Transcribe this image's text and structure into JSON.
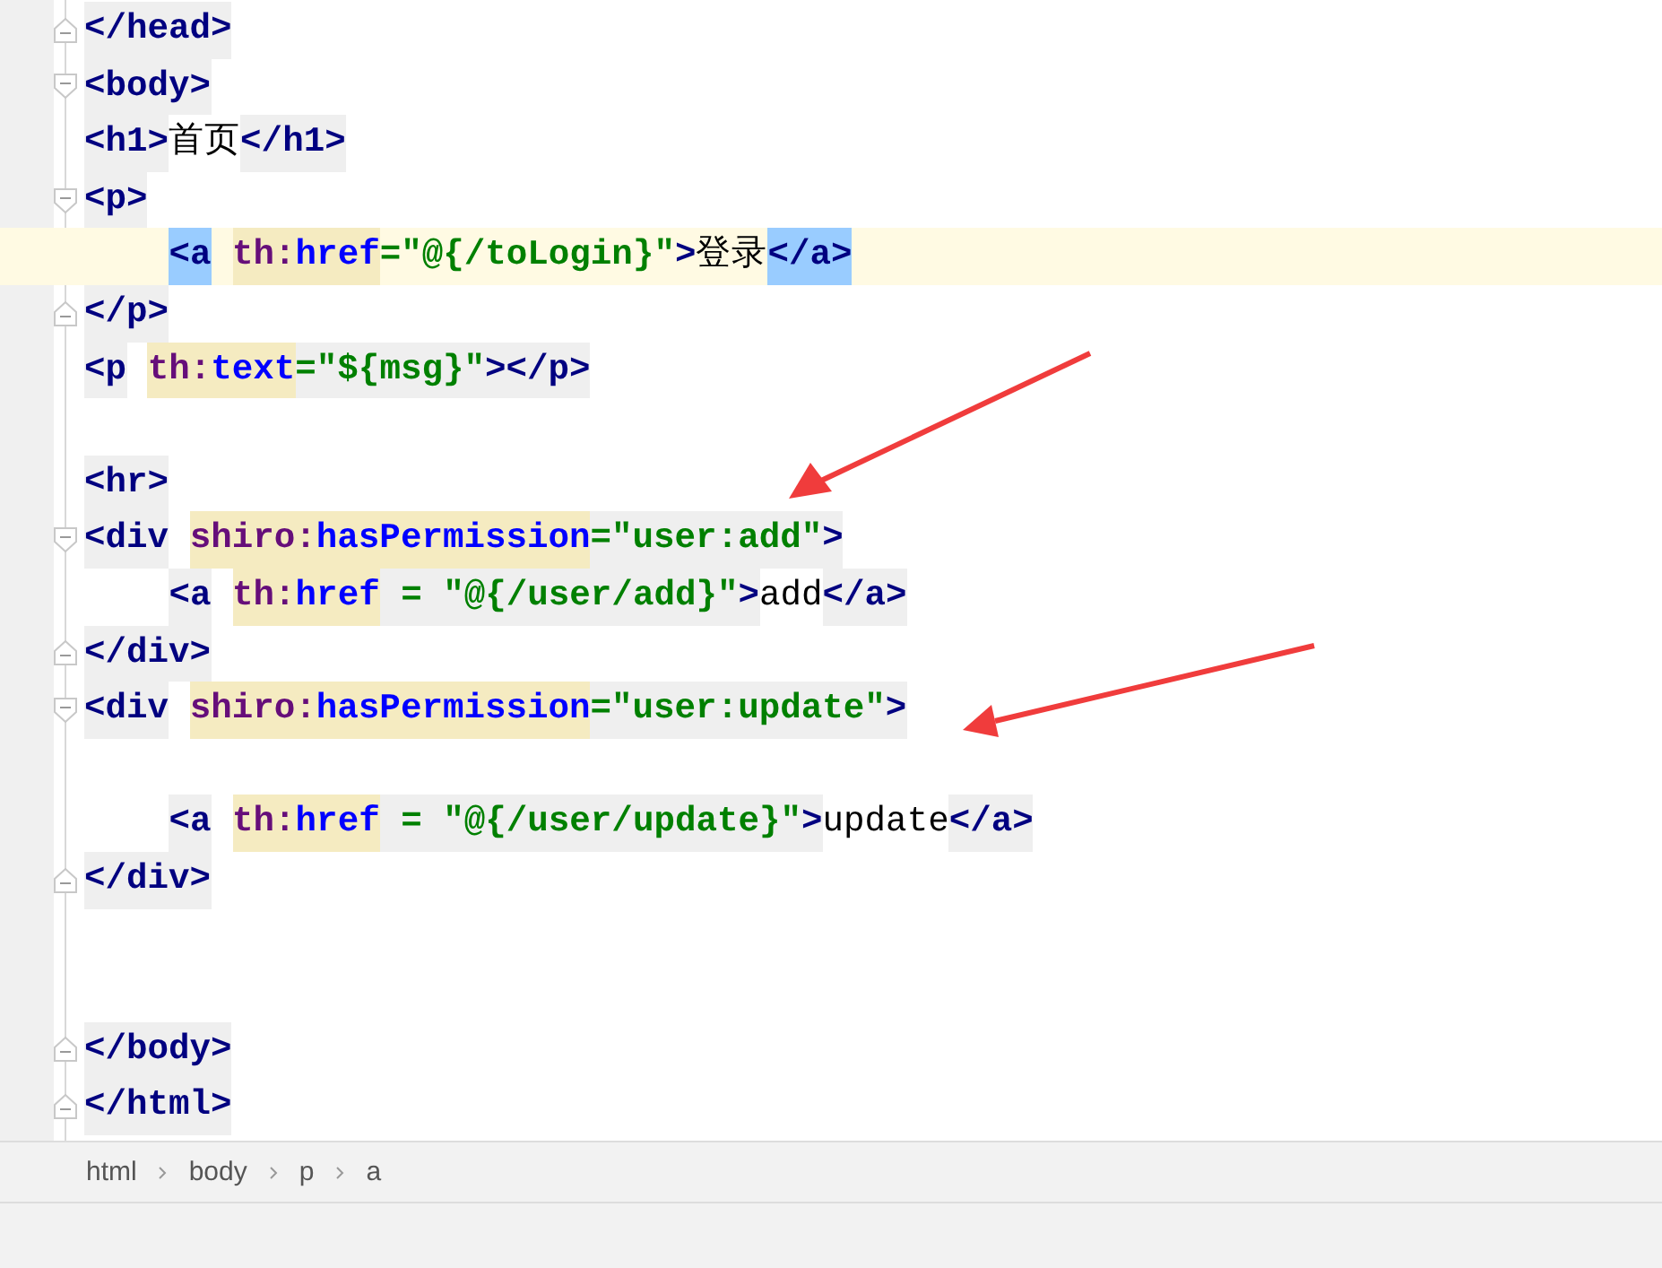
{
  "editor": {
    "lines": [
      {
        "fold_open": false,
        "fold_close": true,
        "current": false,
        "tokens": [
          {
            "kind": "tag",
            "text": "</head>",
            "in_tag": true,
            "matched": false
          }
        ]
      },
      {
        "fold_open": true,
        "fold_close": false,
        "current": false,
        "tokens": [
          {
            "kind": "tag",
            "text": "<body>",
            "in_tag": true,
            "matched": false
          }
        ]
      },
      {
        "fold_open": false,
        "fold_close": false,
        "current": false,
        "tokens": [
          {
            "kind": "tag",
            "text": "<h1>",
            "in_tag": true,
            "matched": false
          },
          {
            "kind": "text",
            "text": "首页",
            "in_tag": false,
            "matched": false
          },
          {
            "kind": "tag",
            "text": "</h1>",
            "in_tag": true,
            "matched": false
          }
        ]
      },
      {
        "fold_open": true,
        "fold_close": false,
        "current": false,
        "tokens": [
          {
            "kind": "tag",
            "text": "<p>",
            "in_tag": true,
            "matched": false
          }
        ]
      },
      {
        "fold_open": false,
        "fold_close": false,
        "current": true,
        "indented": true,
        "tokens": [
          {
            "kind": "tag",
            "text": "<a",
            "in_tag": false,
            "matched": true
          },
          {
            "kind": "ns",
            "text": "th:"
          },
          {
            "kind": "attr",
            "text": "href"
          },
          {
            "kind": "str",
            "text": "=\"@{/toLogin}\"",
            "in_tag": false,
            "matched": false
          },
          {
            "kind": "tag",
            "text": ">",
            "in_tag": false,
            "matched": false
          },
          {
            "kind": "text",
            "text": "登录",
            "in_tag": false,
            "matched": false
          },
          {
            "kind": "tag",
            "text": "</a>",
            "in_tag": false,
            "matched": true
          }
        ]
      },
      {
        "fold_open": false,
        "fold_close": true,
        "current": false,
        "tokens": [
          {
            "kind": "tag",
            "text": "</p>",
            "in_tag": true,
            "matched": false
          }
        ]
      },
      {
        "fold_open": false,
        "fold_close": false,
        "current": false,
        "tokens": [
          {
            "kind": "tag",
            "text": "<p",
            "in_tag": true,
            "matched": false
          },
          {
            "kind": "ns",
            "text": "th:"
          },
          {
            "kind": "attr",
            "text": "text"
          },
          {
            "kind": "str",
            "text": "=\"${msg}\"",
            "in_tag": true,
            "matched": false
          },
          {
            "kind": "tag",
            "text": "></p>",
            "in_tag": true,
            "matched": false
          }
        ]
      },
      {
        "fold_open": false,
        "fold_close": false,
        "current": false
      },
      {
        "fold_open": false,
        "fold_close": false,
        "current": false,
        "tokens": [
          {
            "kind": "tag",
            "text": "<hr>",
            "in_tag": true,
            "matched": false
          }
        ]
      },
      {
        "fold_open": true,
        "fold_close": false,
        "current": false,
        "tokens": [
          {
            "kind": "tag",
            "text": "<div",
            "in_tag": true,
            "matched": false
          },
          {
            "kind": "ns",
            "text": "shiro:"
          },
          {
            "kind": "attr",
            "text": "hasPermission"
          },
          {
            "kind": "str",
            "text": "=\"user:add\"",
            "in_tag": true,
            "matched": false
          },
          {
            "kind": "tag",
            "text": ">",
            "in_tag": true,
            "matched": false
          }
        ]
      },
      {
        "fold_open": false,
        "fold_close": false,
        "current": false,
        "indented": true,
        "tokens": [
          {
            "kind": "tag",
            "text": "<a",
            "in_tag": true,
            "matched": false
          },
          {
            "kind": "ns",
            "text": "th:"
          },
          {
            "kind": "attr",
            "text": "href"
          },
          {
            "kind": "str",
            "text": " = \"@{/user/add}\"",
            "in_tag": true,
            "matched": false
          },
          {
            "kind": "tag",
            "text": ">",
            "in_tag": true,
            "matched": false
          },
          {
            "kind": "text",
            "text": "add",
            "in_tag": false,
            "matched": false
          },
          {
            "kind": "tag",
            "text": "</a>",
            "in_tag": true,
            "matched": false
          }
        ]
      },
      {
        "fold_open": false,
        "fold_close": true,
        "current": false,
        "tokens": [
          {
            "kind": "tag",
            "text": "</div>",
            "in_tag": true,
            "matched": false
          }
        ]
      },
      {
        "fold_open": true,
        "fold_close": false,
        "current": false,
        "tokens": [
          {
            "kind": "tag",
            "text": "<div",
            "in_tag": true,
            "matched": false
          },
          {
            "kind": "ns",
            "text": "shiro:"
          },
          {
            "kind": "attr",
            "text": "hasPermission"
          },
          {
            "kind": "str",
            "text": "=\"user:update\"",
            "in_tag": true,
            "matched": false
          },
          {
            "kind": "tag",
            "text": ">",
            "in_tag": true,
            "matched": false
          }
        ]
      },
      {
        "fold_open": false,
        "fold_close": false,
        "current": false
      },
      {
        "fold_open": false,
        "fold_close": false,
        "current": false,
        "indented": true,
        "tokens": [
          {
            "kind": "tag",
            "text": "<a",
            "in_tag": true,
            "matched": false
          },
          {
            "kind": "ns",
            "text": "th:"
          },
          {
            "kind": "attr",
            "text": "href"
          },
          {
            "kind": "str",
            "text": " = \"@{/user/update}\"",
            "in_tag": true,
            "matched": false
          },
          {
            "kind": "tag",
            "text": ">",
            "in_tag": true,
            "matched": false
          },
          {
            "kind": "text",
            "text": "update",
            "in_tag": false,
            "matched": false
          },
          {
            "kind": "tag",
            "text": "</a>",
            "in_tag": true,
            "matched": false
          }
        ]
      },
      {
        "fold_open": false,
        "fold_close": true,
        "current": false,
        "tokens": [
          {
            "kind": "tag",
            "text": "</div>",
            "in_tag": true,
            "matched": false
          }
        ]
      },
      {
        "fold_open": false,
        "fold_close": false,
        "current": false
      },
      {
        "fold_open": false,
        "fold_close": false,
        "current": false
      },
      {
        "fold_open": false,
        "fold_close": true,
        "current": false,
        "tokens": [
          {
            "kind": "tag",
            "text": "</body>",
            "in_tag": true,
            "matched": false
          }
        ]
      },
      {
        "fold_open": false,
        "fold_close": true,
        "current": false,
        "tokens": [
          {
            "kind": "tag",
            "text": "</html>",
            "in_tag": true,
            "matched": false
          }
        ]
      }
    ]
  },
  "breadcrumb": [
    "html",
    "body",
    "p",
    "a"
  ]
}
